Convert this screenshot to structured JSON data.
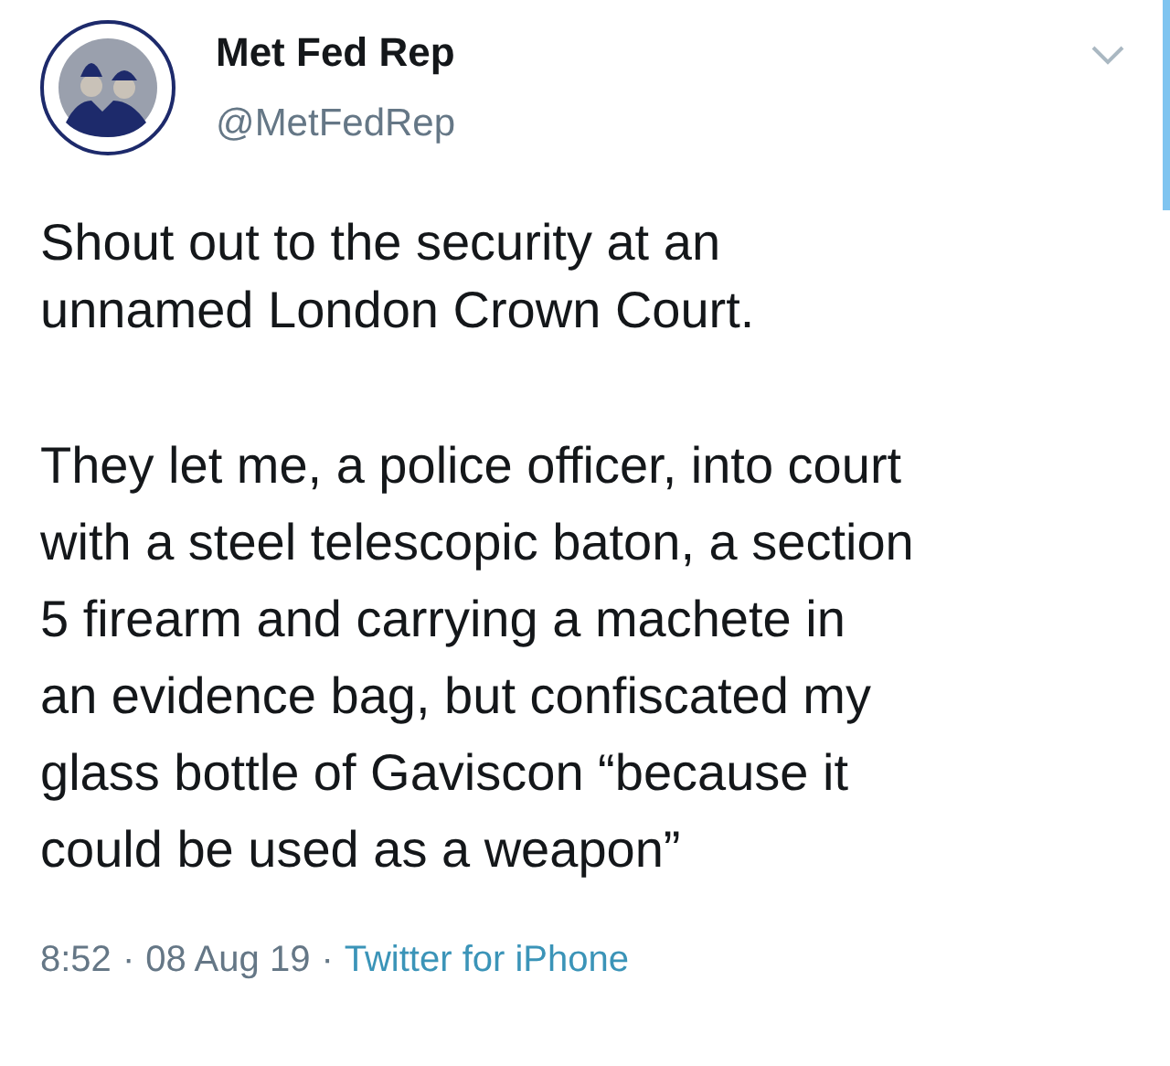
{
  "tweet": {
    "author": {
      "name": "Met Fed Rep",
      "handle": "@MetFedRep"
    },
    "paragraphs": [
      [
        "Shout out to the security at an",
        "unnamed London Crown Court."
      ],
      [
        "They let me, a police officer, into court",
        "with a steel telescopic baton, a section",
        "5 firearm and carrying a machete in",
        "an evidence bag, but confiscated my",
        "glass bottle of Gaviscon “because it",
        "could be used as a weapon”"
      ]
    ],
    "time": "8:52",
    "separator": "·",
    "date": "08 Aug 19",
    "source": "Twitter for iPhone"
  }
}
